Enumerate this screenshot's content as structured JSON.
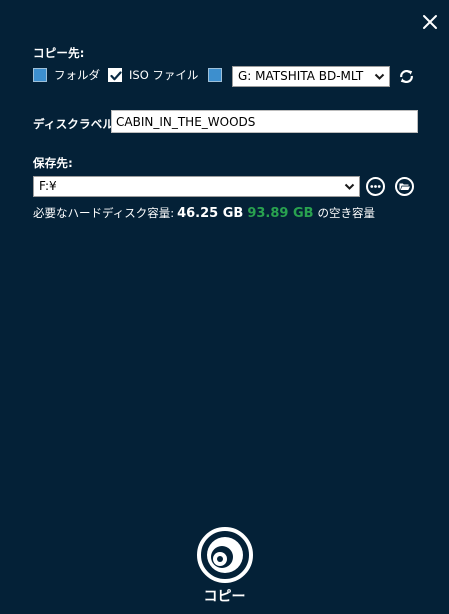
{
  "copy_destination": {
    "label": "コピー先:",
    "folder_label": "フォルダ",
    "folder_checked": false,
    "iso_label": "ISO ファイル",
    "iso_checked": true,
    "drive_checked": false,
    "drive_value": "G: MATSHITA BD-MLT"
  },
  "disc_label": {
    "label": "ディスクラベル:",
    "value": "CABIN_IN_THE_WOODS"
  },
  "save_to": {
    "label": "保存先:",
    "path": "F:¥"
  },
  "disk_info": {
    "label": "必要なハードディスク容量:",
    "required": "46.25 GB",
    "free": "93.89 GB",
    "free_suffix": "の空き容量"
  },
  "copy_button": {
    "label": "コピー"
  },
  "colors": {
    "background": "#042137",
    "checkbox": "#3d8fce",
    "free_space": "#29a24f"
  }
}
